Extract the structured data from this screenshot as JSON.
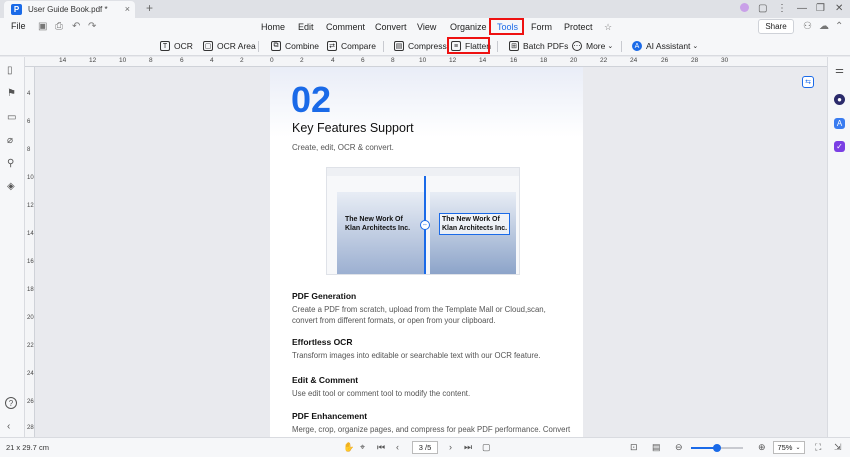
{
  "window": {
    "tab_title": "User Guide Book.pdf *",
    "tab_close": "×",
    "new_tab": "+",
    "min": "—",
    "restore": "❐",
    "close": "✕"
  },
  "menubar": {
    "file": "File",
    "menus": [
      "Home",
      "Edit",
      "Comment",
      "Convert",
      "View",
      "Organize",
      "Tools",
      "Form",
      "Protect"
    ],
    "active": "Tools",
    "share": "Share"
  },
  "toolbar": {
    "items": [
      "OCR",
      "OCR Area",
      "Combine",
      "Compare",
      "Compress",
      "Flatten",
      "Batch PDFs",
      "More",
      "AI Assistant"
    ]
  },
  "rulers": {
    "h_labels": [
      "14",
      "12",
      "10",
      "8",
      "6",
      "4",
      "2",
      "0",
      "2",
      "4",
      "6",
      "8",
      "10",
      "12",
      "14",
      "16",
      "18",
      "20",
      "22",
      "24",
      "26",
      "28",
      "30"
    ],
    "v_labels": [
      "4",
      "6",
      "8",
      "10",
      "12",
      "14",
      "16",
      "18",
      "20",
      "22",
      "24",
      "26",
      "28"
    ]
  },
  "page": {
    "number": "02",
    "heading": "Key Features Support",
    "subheading": "Create, edit, OCR & convert.",
    "screenshot_title_line1": "The New Work Of",
    "screenshot_title_line2": "Klan Architects Inc.",
    "sections": [
      {
        "title": "PDF Generation",
        "body": "Create a PDF from scratch, upload from the Template Mall or Cloud,scan, convert from different formats, or open from your clipboard."
      },
      {
        "title": "Effortless OCR",
        "body": "Transform images into editable or searchable text with our OCR feature."
      },
      {
        "title": "Edit & Comment",
        "body": "Use edit tool or comment tool to modify the content."
      },
      {
        "title": "PDF Enhancement",
        "body": "Merge, crop, organize pages, and compress for peak PDF performance. Convert with ease to various formats. Premium members enjoy enhanced"
      }
    ]
  },
  "status": {
    "page_size": "21 x 29.7 cm",
    "current_page": "3 /5",
    "zoom": "75%",
    "zoom_fraction": 0.5
  }
}
